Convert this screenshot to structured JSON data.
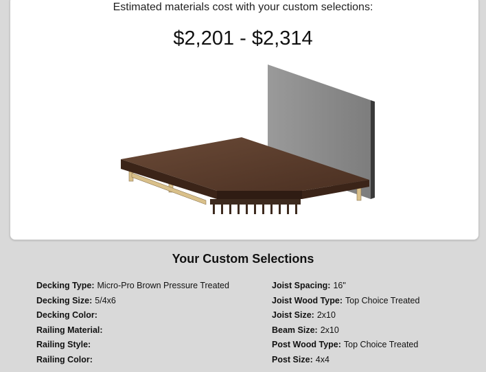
{
  "summary": {
    "cost_label": "Estimated materials cost with your custom selections:",
    "cost_range": "$2,201 - $2,314"
  },
  "selections": {
    "title": "Your Custom Selections",
    "left": [
      {
        "label": "Decking Type:",
        "value": "Micro-Pro Brown Pressure Treated"
      },
      {
        "label": "Decking Size:",
        "value": "5/4x6"
      },
      {
        "label": "Decking Color:",
        "value": ""
      },
      {
        "label": "Railing Material:",
        "value": ""
      },
      {
        "label": "Railing Style:",
        "value": ""
      },
      {
        "label": "Railing Color:",
        "value": ""
      }
    ],
    "right": [
      {
        "label": "Joist Spacing:",
        "value": "16\""
      },
      {
        "label": "Joist Wood Type:",
        "value": "Top Choice Treated"
      },
      {
        "label": "Joist Size:",
        "value": "2x10"
      },
      {
        "label": "Beam Size:",
        "value": "2x10"
      },
      {
        "label": "Post Wood Type:",
        "value": "Top Choice Treated"
      },
      {
        "label": "Post Size:",
        "value": "4x4"
      }
    ]
  },
  "colors": {
    "page_bg": "#d9d9d9",
    "deck_brown": "#5a3d2c",
    "deck_edge": "#3b2418",
    "wall_gray": "#8a8a8a",
    "lumber": "#d9c08a"
  }
}
